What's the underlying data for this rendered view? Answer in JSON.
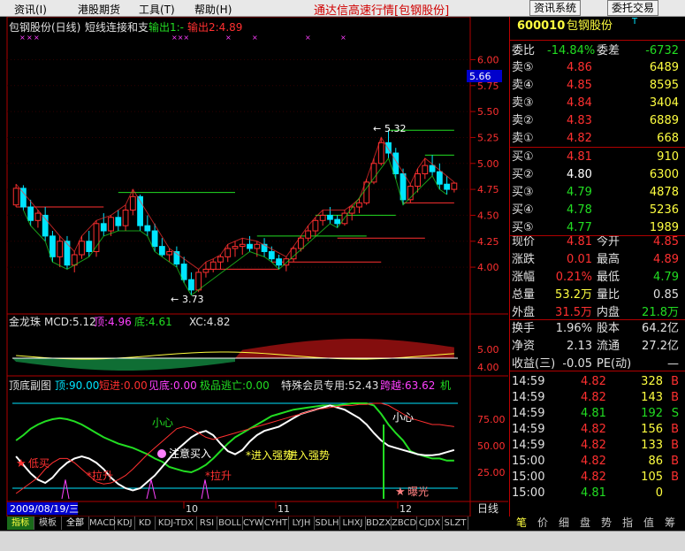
{
  "menu": {
    "items": [
      "资讯(I)",
      "港股期货",
      "工具(T)",
      "帮助(H)"
    ],
    "title": "通达信高速行情[包钢股份]",
    "buttons": [
      "资讯系统",
      "委托交易"
    ]
  },
  "main_header": {
    "title": "包钢股份(日线)",
    "indicator": "短线连接和支",
    "out1": "输出1:-",
    "out2": "输出2:4.89"
  },
  "price_marker": "5.66",
  "annotations": {
    "high": "5.32",
    "low": "3.73"
  },
  "jlz_header": {
    "name": "金龙珠",
    "mcd": "MCD:5.12",
    "ding": "顶:4.96",
    "di": "底:4.61",
    "xc": "XC:4.82"
  },
  "osc_header": {
    "name": "顶底副图",
    "top": "顶:90.00",
    "dz": "短进:0.00",
    "jd": "见底:0.00",
    "jp": "极品逃亡:0.00",
    "vip": "特殊会员专用:52.43",
    "kt": "跨越:63.62",
    "ji": "机"
  },
  "signals": [
    "低买",
    "拉升",
    "注意买入",
    "拉升",
    "进入强势",
    "进入强势",
    "小心",
    "小心",
    "曝光"
  ],
  "date_label": "2009/08/19/三",
  "period_label": "日线",
  "chart_data": [
    {
      "type": "candlestick",
      "title": "包钢股份(日线)",
      "ylim": [
        3.6,
        6.2
      ],
      "y_ticks": [
        4.0,
        4.25,
        4.5,
        4.75,
        5.0,
        5.25,
        5.5,
        5.75,
        6.0
      ],
      "x_labels": [
        "10",
        "11",
        "12"
      ],
      "ohlc": [
        [
          4.6,
          4.8,
          4.58,
          4.76
        ],
        [
          4.76,
          4.79,
          4.55,
          4.58
        ],
        [
          4.58,
          4.65,
          4.4,
          4.45
        ],
        [
          4.45,
          4.55,
          4.38,
          4.52
        ],
        [
          4.5,
          4.58,
          4.25,
          4.3
        ],
        [
          4.3,
          4.35,
          4.05,
          4.1
        ],
        [
          4.1,
          4.3,
          4.0,
          4.25
        ],
        [
          4.25,
          4.3,
          3.98,
          4.02
        ],
        [
          4.02,
          4.15,
          3.95,
          4.12
        ],
        [
          4.12,
          4.3,
          4.08,
          4.25
        ],
        [
          4.25,
          4.35,
          4.1,
          4.15
        ],
        [
          4.15,
          4.45,
          4.1,
          4.42
        ],
        [
          4.42,
          4.52,
          4.3,
          4.35
        ],
        [
          4.35,
          4.5,
          4.3,
          4.48
        ],
        [
          4.48,
          4.55,
          4.35,
          4.4
        ],
        [
          4.4,
          4.6,
          4.35,
          4.55
        ],
        [
          4.55,
          4.75,
          4.5,
          4.68
        ],
        [
          4.68,
          4.7,
          4.35,
          4.4
        ],
        [
          4.4,
          4.5,
          4.3,
          4.35
        ],
        [
          4.35,
          4.42,
          4.15,
          4.2
        ],
        [
          4.2,
          4.28,
          4.1,
          4.12
        ],
        [
          4.12,
          4.18,
          4.05,
          4.15
        ],
        [
          4.15,
          4.2,
          4.0,
          4.03
        ],
        [
          4.03,
          4.1,
          3.85,
          3.88
        ],
        [
          3.88,
          3.95,
          3.73,
          3.78
        ],
        [
          3.78,
          3.98,
          3.76,
          3.95
        ],
        [
          3.95,
          4.05,
          3.9,
          3.98
        ],
        [
          3.98,
          4.08,
          3.95,
          4.05
        ],
        [
          4.05,
          4.12,
          3.98,
          4.1
        ],
        [
          4.1,
          4.22,
          4.05,
          4.18
        ],
        [
          4.18,
          4.25,
          4.1,
          4.2
        ],
        [
          4.2,
          4.28,
          4.12,
          4.22
        ],
        [
          4.22,
          4.3,
          4.15,
          4.18
        ],
        [
          4.18,
          4.25,
          4.1,
          4.22
        ],
        [
          4.22,
          4.28,
          4.1,
          4.15
        ],
        [
          4.15,
          4.2,
          4.05,
          4.08
        ],
        [
          4.08,
          4.12,
          3.98,
          4.02
        ],
        [
          4.02,
          4.1,
          3.96,
          4.08
        ],
        [
          4.08,
          4.2,
          4.05,
          4.18
        ],
        [
          4.18,
          4.3,
          4.15,
          4.28
        ],
        [
          4.28,
          4.4,
          4.25,
          4.35
        ],
        [
          4.35,
          4.48,
          4.3,
          4.45
        ],
        [
          4.45,
          4.55,
          4.4,
          4.5
        ],
        [
          4.5,
          4.58,
          4.42,
          4.46
        ],
        [
          4.46,
          4.5,
          4.38,
          4.42
        ],
        [
          4.42,
          4.55,
          4.4,
          4.52
        ],
        [
          4.52,
          4.6,
          4.45,
          4.58
        ],
        [
          4.58,
          4.66,
          4.52,
          4.62
        ],
        [
          4.62,
          4.85,
          4.6,
          4.82
        ],
        [
          4.82,
          5.05,
          4.8,
          5.0
        ],
        [
          5.0,
          5.25,
          4.98,
          5.2
        ],
        [
          5.2,
          5.32,
          5.05,
          5.1
        ],
        [
          5.1,
          5.15,
          4.85,
          4.9
        ],
        [
          4.9,
          4.95,
          4.6,
          4.65
        ],
        [
          4.65,
          4.8,
          4.62,
          4.78
        ],
        [
          4.78,
          4.95,
          4.72,
          4.9
        ],
        [
          4.9,
          5.05,
          4.85,
          4.98
        ],
        [
          4.98,
          5.08,
          4.88,
          4.92
        ],
        [
          4.92,
          5.0,
          4.75,
          4.8
        ],
        [
          4.8,
          4.88,
          4.7,
          4.75
        ],
        [
          4.75,
          4.82,
          4.72,
          4.81
        ]
      ],
      "support_lines": [
        {
          "from": 0,
          "to": 12,
          "y": 4.58
        },
        {
          "from": 14,
          "to": 30,
          "y": 4.72
        },
        {
          "from": 26,
          "to": 36,
          "y": 3.98
        },
        {
          "from": 33,
          "to": 48,
          "y": 4.3
        },
        {
          "from": 35,
          "to": 50,
          "y": 4.05
        },
        {
          "from": 41,
          "to": 52,
          "y": 4.5
        },
        {
          "from": 44,
          "to": 56,
          "y": 4.28
        },
        {
          "from": 51,
          "to": 60,
          "y": 5.32
        },
        {
          "from": 53,
          "to": 60,
          "y": 4.62
        },
        {
          "from": 56,
          "to": 60,
          "y": 5.08
        }
      ]
    },
    {
      "type": "area",
      "title": "金龙珠",
      "ylim": [
        3.6,
        6.2
      ],
      "y_ticks": [
        4.0,
        5.0
      ]
    },
    {
      "type": "line",
      "title": "顶底副图",
      "ylim": [
        0,
        100
      ],
      "y_ticks": [
        25.0,
        50.0,
        75.0
      ],
      "series": [
        {
          "name": "",
          "values": [
            55,
            60,
            66,
            70,
            73,
            75,
            76,
            75,
            73,
            70,
            66,
            62,
            58,
            55,
            52,
            50,
            48,
            45,
            42,
            38,
            35,
            30,
            28,
            26,
            25,
            28,
            32,
            38,
            45,
            52,
            58,
            62,
            66,
            70,
            74,
            78,
            80,
            82,
            84,
            85,
            86,
            87,
            88,
            88,
            88,
            89,
            90,
            90,
            90,
            88,
            80,
            70,
            62,
            55,
            45,
            42,
            40,
            38,
            38,
            36,
            36
          ]
        },
        {
          "name": "",
          "values": [
            40,
            32,
            24,
            18,
            15,
            20,
            28,
            34,
            38,
            40,
            38,
            34,
            28,
            20,
            14,
            10,
            8,
            10,
            16,
            22,
            30,
            38,
            46,
            52,
            58,
            62,
            64,
            60,
            52,
            45,
            42,
            46,
            54,
            60,
            64,
            66,
            68,
            72,
            76,
            80,
            82,
            84,
            86,
            88,
            86,
            84,
            80,
            76,
            70,
            62,
            55,
            50,
            48,
            46,
            44,
            42,
            41,
            41,
            42,
            44,
            46
          ]
        },
        {
          "name": "",
          "values": [
            5,
            10,
            15,
            20,
            28,
            34,
            38,
            38,
            34,
            28,
            22,
            16,
            14,
            15,
            18,
            22,
            28,
            35,
            42,
            48,
            54,
            60,
            66,
            68,
            66,
            62,
            58,
            56,
            58,
            60,
            62,
            64,
            66,
            68,
            70,
            72,
            74,
            76,
            78,
            80,
            82,
            84,
            85,
            86,
            87,
            88,
            88,
            89,
            89,
            90,
            90,
            88,
            84,
            80,
            76,
            74,
            72,
            70,
            70,
            69,
            68
          ]
        }
      ]
    }
  ],
  "stock": {
    "code": "600010",
    "name": "包钢股份",
    "flag": "T",
    "wb_label": "委比",
    "wb_value": "-14.84%",
    "wc_label": "委差",
    "wc_value": "-6732",
    "asks": [
      {
        "label": "卖⑤",
        "price": "4.86",
        "vol": "6489"
      },
      {
        "label": "卖④",
        "price": "4.85",
        "vol": "8595"
      },
      {
        "label": "卖③",
        "price": "4.84",
        "vol": "3404"
      },
      {
        "label": "卖②",
        "price": "4.83",
        "vol": "6889"
      },
      {
        "label": "卖①",
        "price": "4.82",
        "vol": "668"
      }
    ],
    "bids": [
      {
        "label": "买①",
        "price": "4.81",
        "vol": "910"
      },
      {
        "label": "买②",
        "price": "4.80",
        "vol": "6300"
      },
      {
        "label": "买③",
        "price": "4.79",
        "vol": "4878"
      },
      {
        "label": "买④",
        "price": "4.78",
        "vol": "5236"
      },
      {
        "label": "买⑤",
        "price": "4.77",
        "vol": "1989"
      }
    ],
    "stats": [
      {
        "l1": "现价",
        "v1": "4.81",
        "l2": "今开",
        "v2": "4.85"
      },
      {
        "l1": "涨跌",
        "v1": "0.01",
        "l2": "最高",
        "v2": "4.89"
      },
      {
        "l1": "涨幅",
        "v1": "0.21%",
        "l2": "最低",
        "v2": "4.79"
      },
      {
        "l1": "总量",
        "v1": "53.2万",
        "l2": "量比",
        "v2": "0.85"
      },
      {
        "l1": "外盘",
        "v1": "31.5万",
        "l2": "内盘",
        "v2": "21.8万"
      }
    ],
    "stats2": [
      {
        "l1": "换手",
        "v1": "1.96%",
        "l2": "股本",
        "v2": "64.2亿"
      },
      {
        "l1": "净资",
        "v1": "2.13",
        "l2": "流通",
        "v2": "27.2亿"
      },
      {
        "l1": "收益(三)",
        "v1": "-0.05",
        "l2": "PE(动)",
        "v2": "—"
      }
    ],
    "ticks": [
      {
        "t": "14:59",
        "p": "4.82",
        "v": "328",
        "d": "B"
      },
      {
        "t": "14:59",
        "p": "4.82",
        "v": "143",
        "d": "B"
      },
      {
        "t": "14:59",
        "p": "4.81",
        "v": "192",
        "d": "S"
      },
      {
        "t": "14:59",
        "p": "4.82",
        "v": "156",
        "d": "B"
      },
      {
        "t": "14:59",
        "p": "4.82",
        "v": "133",
        "d": "B"
      },
      {
        "t": "15:00",
        "p": "4.82",
        "v": "86",
        "d": "B"
      },
      {
        "t": "15:00",
        "p": "4.82",
        "v": "105",
        "d": "B"
      },
      {
        "t": "15:00",
        "p": "4.81",
        "v": "0",
        "d": ""
      }
    ]
  },
  "bottom_tabs": [
    "指标",
    "模板",
    "全部",
    "MACD",
    "KDJ",
    "KD",
    "KDJ-TDX",
    "RSI",
    "BOLL",
    "CYW",
    "CYHT",
    "LYJH",
    "SDLH",
    "LHXJ",
    "BDZX",
    "ZBCD",
    "CJDX",
    "SLZT"
  ],
  "right_tabs": [
    "笔",
    "价",
    "细",
    "盘",
    "势",
    "指",
    "值",
    "筹"
  ]
}
